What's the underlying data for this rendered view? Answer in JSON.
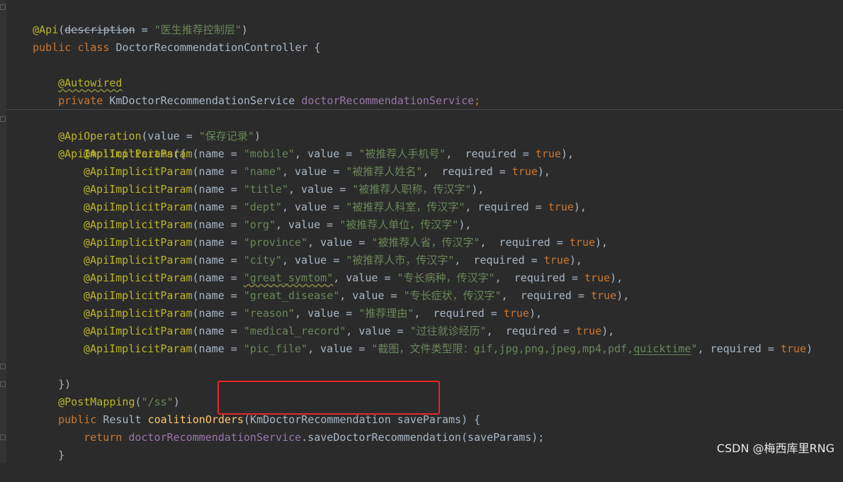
{
  "editor": {
    "lines": {
      "l1": {
        "ann": "@Api",
        "p1": "(",
        "attr": "description",
        "p2": " = ",
        "str": "\"医生推荐控制层\"",
        "p3": ")"
      },
      "l2": {
        "kw1": "public",
        "kw2": " class ",
        "name": "DoctorRecommendationController {"
      },
      "l4": {
        "ann": "@Autowired"
      },
      "l5": {
        "kw": "private",
        "type": " KmDoctorRecommendationService ",
        "field": "doctorRecommendationService",
        "end": ";"
      },
      "l7": {
        "ann": "@ApiOperation",
        "pre": "(value = ",
        "str": "\"保存记录\"",
        "end": ")"
      },
      "l8": {
        "ann": "@ApiImplicitParams",
        "end": "({"
      },
      "params": [
        {
          "ann": "@ApiImplicitParam",
          "a": "(name = ",
          "name": "\"mobile\"",
          "b": ", value = ",
          "value": "\"被推荐人手机号\"",
          "c": ",  required = ",
          "req": "true",
          "d": "),"
        },
        {
          "ann": "@ApiImplicitParam",
          "a": "(name = ",
          "name": "\"name\"",
          "b": ", value = ",
          "value": "\"被推荐人姓名\"",
          "c": ",  required = ",
          "req": "true",
          "d": "),"
        },
        {
          "ann": "@ApiImplicitParam",
          "a": "(name = ",
          "name": "\"title\"",
          "b": ", value = ",
          "value": "\"被推荐人职称，传汉字\"",
          "c": "",
          "req": "",
          "d": "),"
        },
        {
          "ann": "@ApiImplicitParam",
          "a": "(name = ",
          "name": "\"dept\"",
          "b": ", value = ",
          "value": "\"被推荐人科室，传汉字\"",
          "c": ", required = ",
          "req": "true",
          "d": "),"
        },
        {
          "ann": "@ApiImplicitParam",
          "a": "(name = ",
          "name": "\"org\"",
          "b": ", value = ",
          "value": "\"被推荐人单位，传汉字\"",
          "c": "",
          "req": "",
          "d": "),"
        },
        {
          "ann": "@ApiImplicitParam",
          "a": "(name = ",
          "name": "\"province\"",
          "b": ", value = ",
          "value": "\"被推荐人省，传汉字\"",
          "c": ",  required = ",
          "req": "true",
          "d": "),"
        },
        {
          "ann": "@ApiImplicitParam",
          "a": "(name = ",
          "name": "\"city\"",
          "b": ", value = ",
          "value": "\"被推荐人市，传汉字\"",
          "c": ",  required = ",
          "req": "true",
          "d": "),"
        },
        {
          "ann": "@ApiImplicitParam",
          "a": "(name = ",
          "name": "\"great_symtom\"",
          "b": ", value = ",
          "value": "\"专长病种，传汉字\"",
          "c": ",  required = ",
          "req": "true",
          "d": "),"
        },
        {
          "ann": "@ApiImplicitParam",
          "a": "(name = ",
          "name": "\"great_disease\"",
          "b": ", value = ",
          "value": "\"专长症状，传汉字\"",
          "c": ",  required = ",
          "req": "true",
          "d": "),"
        },
        {
          "ann": "@ApiImplicitParam",
          "a": "(name = ",
          "name": "\"reason\"",
          "b": ", value = ",
          "value": "\"推荐理由\"",
          "c": ",  required = ",
          "req": "true",
          "d": "),"
        },
        {
          "ann": "@ApiImplicitParam",
          "a": "(name = ",
          "name": "\"medical_record\"",
          "b": ", value = ",
          "value": "\"过往就诊经历\"",
          "c": ",  required = ",
          "req": "true",
          "d": "),"
        },
        {
          "ann": "@ApiImplicitParam",
          "a": "(name = ",
          "name": "\"pic_file\"",
          "b": ", value = ",
          "value_pre": "\"截图，文件类型限：gif,jpg,png,jpeg,mp4,pdf,",
          "value_ul": "quicktime",
          "value_post": "\"",
          "c": ", required = ",
          "req": "true",
          "d": ")"
        }
      ],
      "l21": {
        "text": "})"
      },
      "l22": {
        "ann": "@PostMapping",
        "p1": "(",
        "str": "\"/ss\"",
        "p2": ")"
      },
      "l23": {
        "kw": "public",
        "type": " Result ",
        "method": "coalitionOrders",
        "args": "(KmDoctorRecommendation saveParams)",
        "end": " {"
      },
      "l24": {
        "kw": "return",
        "field": " doctorRecommendationService",
        "call": ".saveDoctorRecommendation(saveParams);"
      },
      "l25": {
        "text": "}"
      }
    }
  },
  "watermark": "CSDN @梅西库里RNG",
  "colors": {
    "background": "#2b2b2b",
    "annotation": "#bbb529",
    "keyword": "#cc7832",
    "string": "#6a8759",
    "field": "#9876aa",
    "method": "#ffc66d",
    "highlight_box": "#e8252a"
  }
}
